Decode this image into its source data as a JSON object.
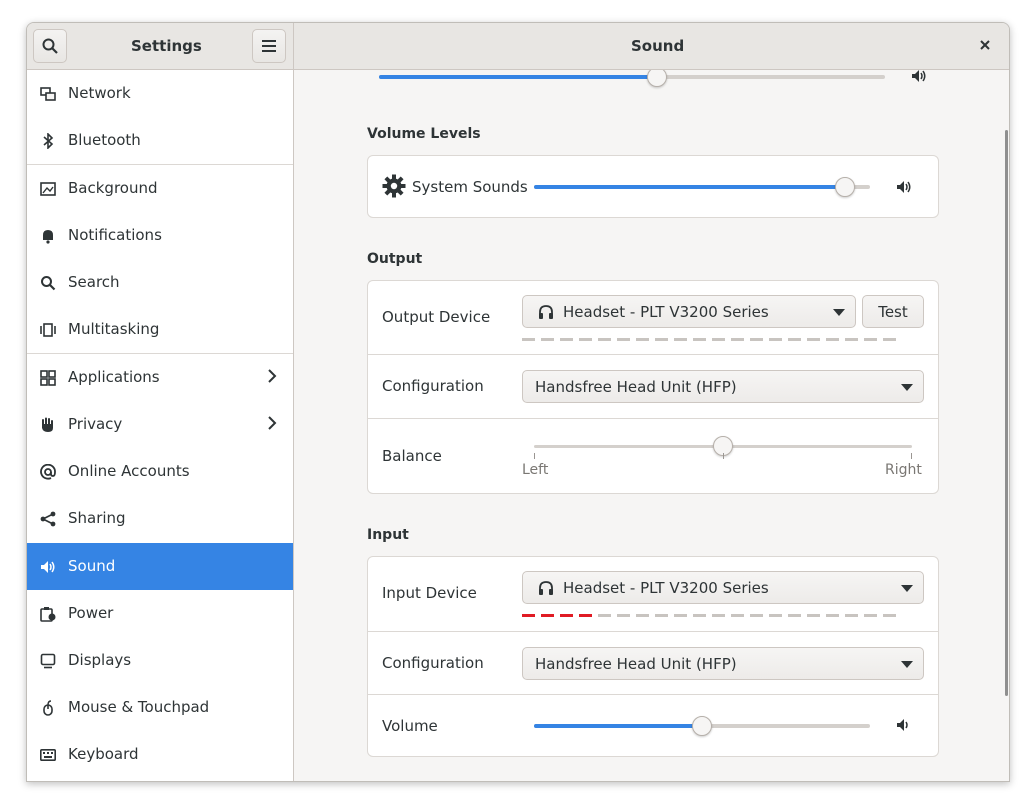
{
  "window": {
    "left_title": "Settings",
    "panel_title": "Sound"
  },
  "sidebar": {
    "items": [
      {
        "label": "Network",
        "icon": "network-icon"
      },
      {
        "label": "Bluetooth",
        "icon": "bluetooth-icon"
      },
      {
        "label": "Background",
        "icon": "background-icon"
      },
      {
        "label": "Notifications",
        "icon": "bell-icon"
      },
      {
        "label": "Search",
        "icon": "search-icon"
      },
      {
        "label": "Multitasking",
        "icon": "multitasking-icon"
      },
      {
        "label": "Applications",
        "icon": "grid-icon",
        "chevron": true
      },
      {
        "label": "Privacy",
        "icon": "hand-icon",
        "chevron": true
      },
      {
        "label": "Online Accounts",
        "icon": "at-icon"
      },
      {
        "label": "Sharing",
        "icon": "share-icon"
      },
      {
        "label": "Sound",
        "icon": "speaker-icon",
        "active": true
      },
      {
        "label": "Power",
        "icon": "power-icon"
      },
      {
        "label": "Displays",
        "icon": "display-icon"
      },
      {
        "label": "Mouse & Touchpad",
        "icon": "mouse-icon"
      },
      {
        "label": "Keyboard",
        "icon": "keyboard-icon"
      }
    ]
  },
  "top_slider": {
    "level": 0.55
  },
  "volume_levels": {
    "title": "Volume Levels",
    "system_sounds_label": "System Sounds",
    "system_sounds_level": 0.925
  },
  "output": {
    "title": "Output",
    "device_label": "Output Device",
    "device_value": "Headset - PLT V3200 Series",
    "test_label": "Test",
    "config_label": "Configuration",
    "config_value": "Handsfree Head Unit (HFP)",
    "balance_label": "Balance",
    "balance_left": "Left",
    "balance_right": "Right",
    "balance_value": 0.5
  },
  "input": {
    "title": "Input",
    "device_label": "Input Device",
    "device_value": "Headset - PLT V3200 Series",
    "config_label": "Configuration",
    "config_value": "Handsfree Head Unit (HFP)",
    "volume_label": "Volume",
    "volume_level": 0.5,
    "input_level_segments_on": 4
  },
  "colors": {
    "accent": "#3584e4",
    "level_active": "#e01b24"
  }
}
